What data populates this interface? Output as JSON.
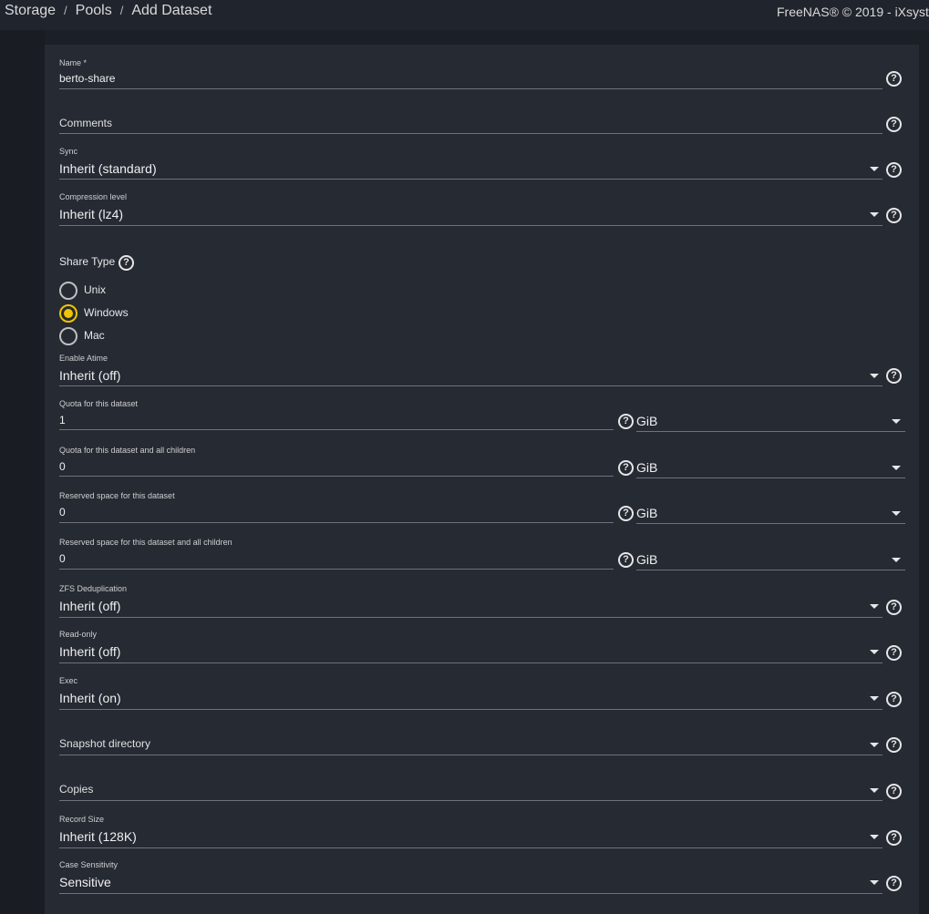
{
  "breadcrumb": [
    "Storage",
    "Pools",
    "Add Dataset"
  ],
  "copyright": "FreeNAS® © 2019 - iXsyst",
  "name_field": {
    "label": "Name *",
    "value": "berto-share"
  },
  "comments_field": {
    "placeholder": "Comments"
  },
  "sync": {
    "label": "Sync",
    "value": "Inherit (standard)"
  },
  "compression": {
    "label": "Compression level",
    "value": "Inherit (lz4)"
  },
  "share_type": {
    "title": "Share Type",
    "options": [
      {
        "label": "Unix",
        "selected": false
      },
      {
        "label": "Windows",
        "selected": true
      },
      {
        "label": "Mac",
        "selected": false
      }
    ]
  },
  "atime": {
    "label": "Enable Atime",
    "value": "Inherit (off)"
  },
  "quota": {
    "label": "Quota for this dataset",
    "value": "1",
    "unit": "GiB"
  },
  "quota_children": {
    "label": "Quota for this dataset and all children",
    "value": "0",
    "unit": "GiB"
  },
  "reserved": {
    "label": "Reserved space for this dataset",
    "value": "0",
    "unit": "GiB"
  },
  "reserved_children": {
    "label": "Reserved space for this dataset and all children",
    "value": "0",
    "unit": "GiB"
  },
  "dedup": {
    "label": "ZFS Deduplication",
    "value": "Inherit (off)"
  },
  "readonly": {
    "label": "Read-only",
    "value": "Inherit (off)"
  },
  "exec": {
    "label": "Exec",
    "value": "Inherit (on)"
  },
  "snapdir": {
    "placeholder": "Snapshot directory"
  },
  "copies": {
    "placeholder": "Copies"
  },
  "recordsize": {
    "label": "Record Size",
    "value": "Inherit (128K)"
  },
  "casesens": {
    "label": "Case Sensitivity",
    "value": "Sensitive"
  },
  "help_glyph": "?",
  "colors": {
    "accent": "#f0c400",
    "card": "#252a33",
    "page": "#1b1f26"
  }
}
